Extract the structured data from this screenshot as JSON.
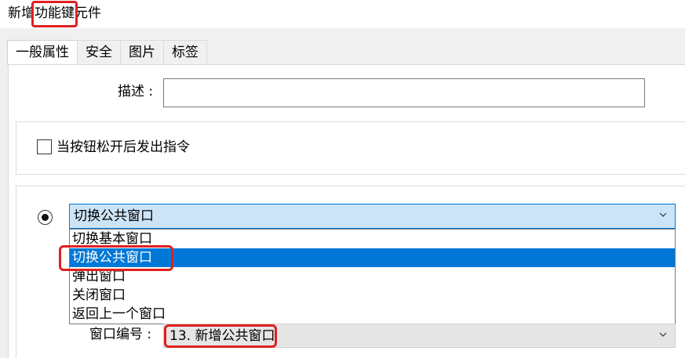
{
  "title": {
    "prefix": "新增",
    "highlight": "功能键",
    "suffix": "元件"
  },
  "tabs": [
    {
      "label": "一般属性",
      "active": true
    },
    {
      "label": "安全",
      "active": false
    },
    {
      "label": "图片",
      "active": false
    },
    {
      "label": "标签",
      "active": false
    }
  ],
  "description": {
    "label": "描述 :",
    "value": ""
  },
  "release_checkbox": {
    "label": "当按钮松开后发出指令",
    "checked": false
  },
  "action_select": {
    "value": "切换公共窗口",
    "options": [
      "切换基本窗口",
      "切换公共窗口",
      "弹出窗口",
      "关闭窗口",
      "返回上一个窗口"
    ],
    "selected_index": 1
  },
  "window_number": {
    "label": "窗口编号 :",
    "value": "13. 新增公共窗口"
  },
  "colors": {
    "highlight": "#e02020",
    "selection": "#0078d7",
    "combo_focus": "#cce4f7"
  }
}
